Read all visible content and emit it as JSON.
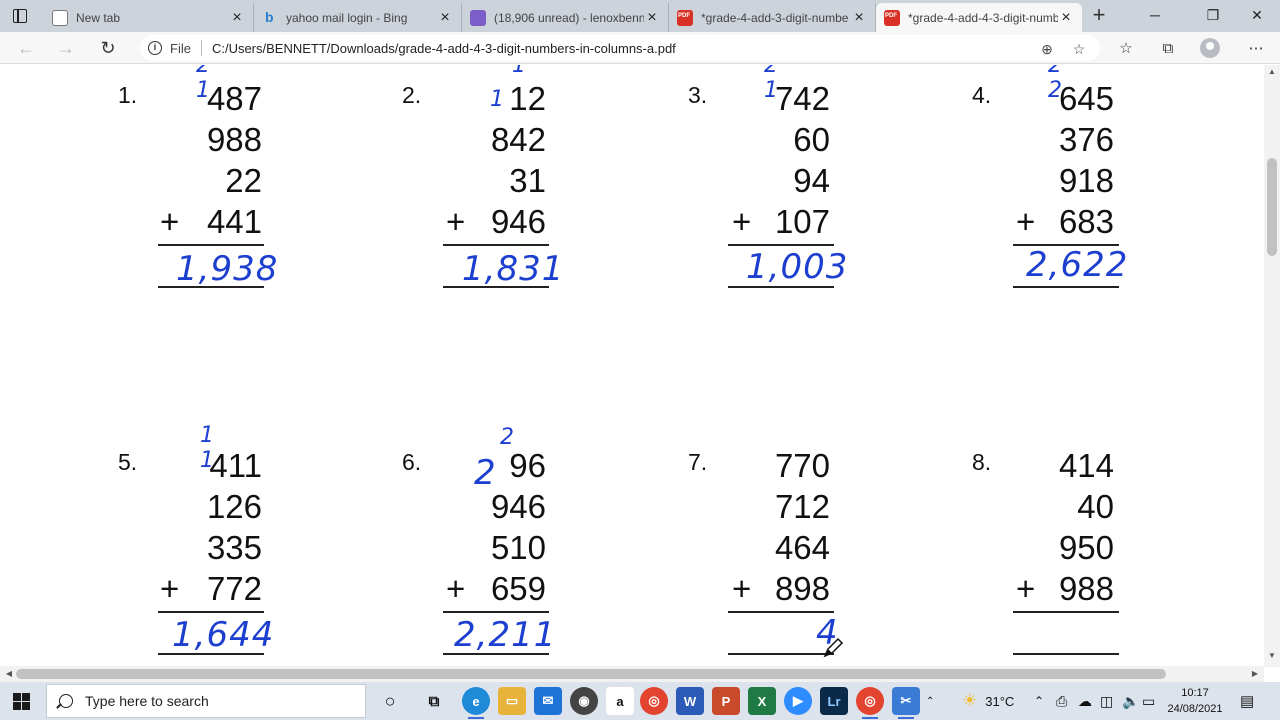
{
  "tabs": [
    {
      "label": "New tab",
      "icon": "new-tab-icon"
    },
    {
      "label": "yahoo mail login - Bing",
      "icon": "bing-icon"
    },
    {
      "label": "(18,906 unread) - lenoxbenne",
      "icon": "mail-icon"
    },
    {
      "label": "*grade-4-add-3-digit-numbe",
      "icon": "pdf-icon"
    },
    {
      "label": "*grade-4-add-4-3-digit-numb",
      "icon": "pdf-icon"
    }
  ],
  "address": {
    "scheme": "File",
    "url": "C:/Users/BENNETT/Downloads/grade-4-add-4-3-digit-numbers-in-columns-a.pdf"
  },
  "worksheet": {
    "problems": [
      {
        "num": "1.",
        "addends": [
          "487",
          "988",
          "22",
          "441"
        ],
        "answer": "1,938",
        "carry": "2 1"
      },
      {
        "num": "2.",
        "addends": [
          "12",
          "842",
          "31",
          "946"
        ],
        "answer": "1,831",
        "carry": "1"
      },
      {
        "num": "3.",
        "addends": [
          "742",
          "60",
          "94",
          "107"
        ],
        "answer": "1,003",
        "carry": "2 1"
      },
      {
        "num": "4.",
        "addends": [
          "645",
          "376",
          "918",
          "683"
        ],
        "answer": "2,622",
        "carry": "2 2"
      },
      {
        "num": "5.",
        "addends": [
          "411",
          "126",
          "335",
          "772"
        ],
        "answer": "1,644",
        "carry": "1 1"
      },
      {
        "num": "6.",
        "addends": [
          "96",
          "946",
          "510",
          "659"
        ],
        "answer": "2,211",
        "carry": "2"
      },
      {
        "num": "7.",
        "addends": [
          "770",
          "712",
          "464",
          "898"
        ],
        "answer": "4",
        "carry": ""
      },
      {
        "num": "8.",
        "addends": [
          "414",
          "40",
          "950",
          "988"
        ],
        "answer": "",
        "carry": ""
      }
    ],
    "plus_sign": "+",
    "margin_digit_6": "2",
    "handwriting_color": "#1d3fcf"
  },
  "taskbar": {
    "search_placeholder": "Type here to search",
    "weather": "31°C",
    "time": "10:17",
    "date": "24/08/2021"
  }
}
